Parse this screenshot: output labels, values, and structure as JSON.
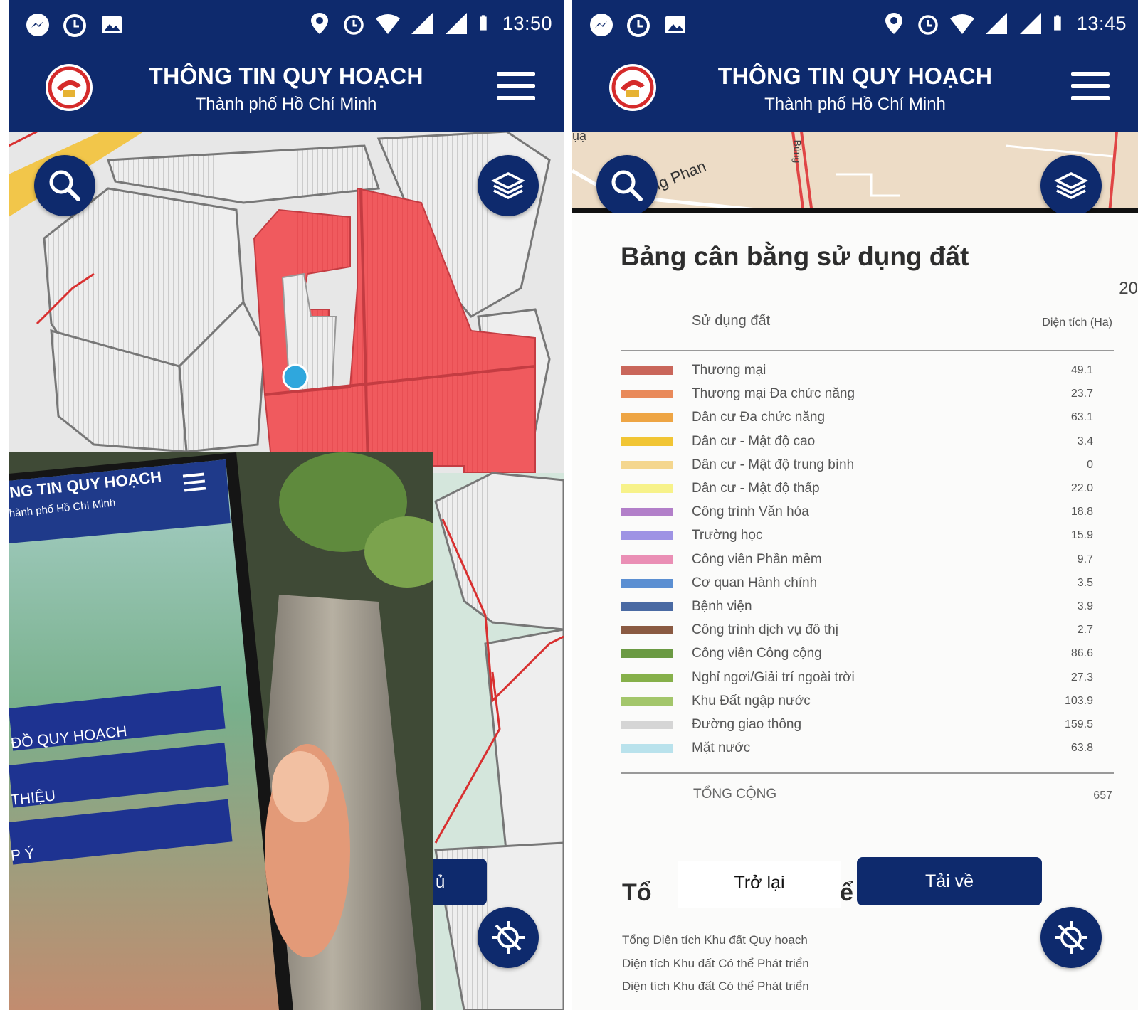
{
  "left": {
    "status_time": "13:50",
    "app_title": "THÔNG TIN QUY HOẠCH",
    "app_subtitle": "Thành phố Hồ Chí Minh",
    "partial_button_label": "ủ",
    "inset_phone": {
      "title": "NG TIN QUY HOẠCH",
      "subtitle": "hành phố Hồ Chí Minh",
      "menu_items": [
        "ĐỒ QUY HOẠCH",
        "THIỆU",
        "P Ý"
      ]
    }
  },
  "right": {
    "status_time": "13:45",
    "app_title": "THÔNG TIN QUY HOẠCH",
    "app_subtitle": "Thành phố Hồ Chí Minh",
    "map_street_label": "ng Phan",
    "map_street_label2": "Bùng",
    "map_corner_label": "ụạ",
    "doc": {
      "title": "Bảng cân bằng sử dụng đất",
      "year_partial": "20",
      "col_land_use": "Sử dụng đất",
      "col_area": "Diện tích (Ha)",
      "rows": [
        {
          "label": "Thương mại",
          "value": "49.1",
          "color": "#c9665a"
        },
        {
          "label": "Thương mại Đa chức năng",
          "value": "23.7",
          "color": "#e98a5a"
        },
        {
          "label": "Dân cư Đa chức năng",
          "value": "63.1",
          "color": "#eea544"
        },
        {
          "label": "Dân cư - Mật độ cao",
          "value": "3.4",
          "color": "#f1c534"
        },
        {
          "label": "Dân cư - Mật độ trung bình",
          "value": "0",
          "color": "#f4d68e"
        },
        {
          "label": "Dân cư - Mật độ thấp",
          "value": "22.0",
          "color": "#f7f28a"
        },
        {
          "label": "Công trình Văn hóa",
          "value": "18.8",
          "color": "#b27fc9"
        },
        {
          "label": "Trường học",
          "value": "15.9",
          "color": "#9e93e4"
        },
        {
          "label": "Công viên Phần mềm",
          "value": "9.7",
          "color": "#ea8fb5"
        },
        {
          "label": "Cơ quan Hành chính",
          "value": "3.5",
          "color": "#5b8fd2"
        },
        {
          "label": "Bệnh viện",
          "value": "3.9",
          "color": "#4a6aa3"
        },
        {
          "label": "Công trình dịch vụ đô thị",
          "value": "2.7",
          "color": "#8a5a42"
        },
        {
          "label": "Công viên Công cộng",
          "value": "86.6",
          "color": "#6b9a43"
        },
        {
          "label": "Nghỉ ngơi/Giải trí ngoài trời",
          "value": "27.3",
          "color": "#86b04a"
        },
        {
          "label": "Khu Đất ngập nước",
          "value": "103.9",
          "color": "#a3c66b"
        },
        {
          "label": "Đường giao thông",
          "value": "159.5",
          "color": "#d5d5d5"
        },
        {
          "label": "Mặt nước",
          "value": "63.8",
          "color": "#b9e2ec"
        }
      ],
      "total_label": "TỔNG CỘNG",
      "total_value": "657",
      "section_partial_left": "Tổ",
      "section_partial_right": "ể",
      "fine_lines": [
        "Tổng Diện tích Khu đất Quy hoạch",
        "Diện tích Khu đất Có thể Phát triển",
        "Diện tích Khu đất Có thể Phát triển"
      ]
    },
    "btn_back": "Trở lại",
    "btn_download": "Tải về"
  },
  "colors": {
    "brand_navy": "#0e2a6d",
    "zone_red": "#f05a5e"
  }
}
